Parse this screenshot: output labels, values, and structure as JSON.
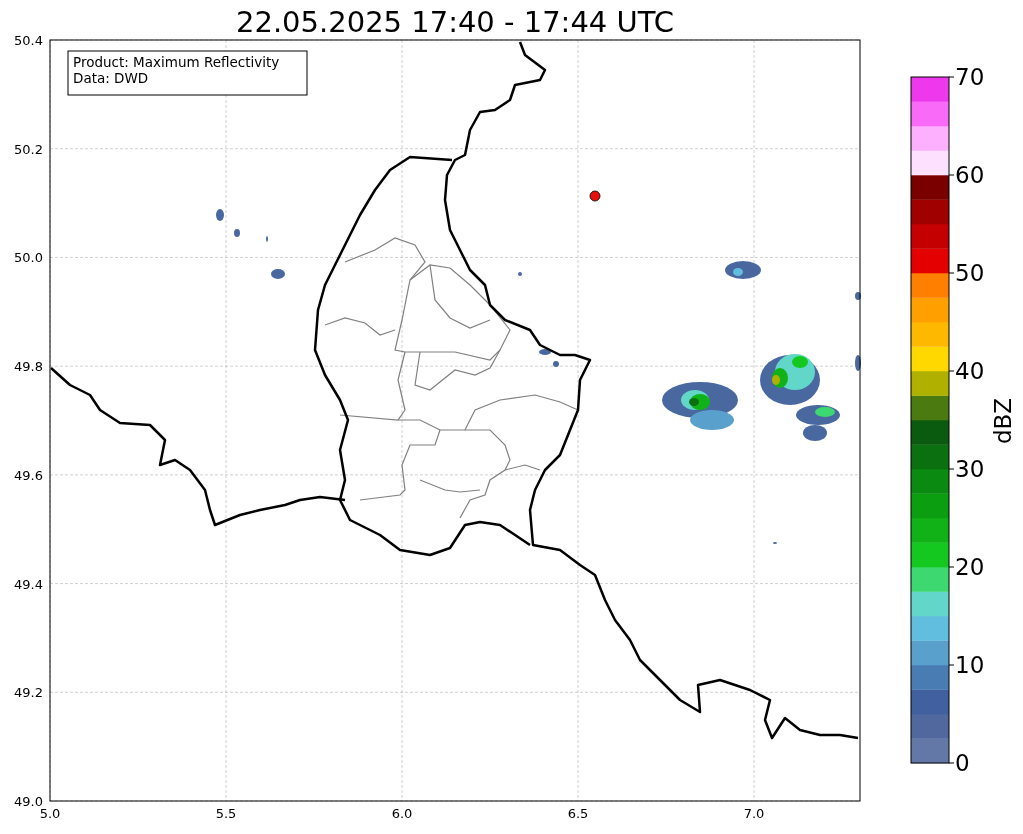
{
  "title": "22.05.2025 17:40 - 17:44 UTC",
  "info_box": {
    "lines": [
      "Product: Maximum Reflectivity",
      "Data: DWD"
    ]
  },
  "map": {
    "xticks": [
      "5.0",
      "5.5",
      "6.0",
      "6.5",
      "7.0"
    ],
    "yticks": [
      "50.4",
      "50.2",
      "50.0",
      "49.8",
      "49.6",
      "49.4",
      "49.2",
      "49.0"
    ]
  },
  "colorbar": {
    "label": "dBZ",
    "ticks": [
      "70",
      "60",
      "50",
      "40",
      "30",
      "20",
      "10",
      "0"
    ],
    "bands": [
      {
        "color": "#6478a8"
      },
      {
        "color": "#50689e"
      },
      {
        "color": "#4060a0"
      },
      {
        "color": "#4a7cb4"
      },
      {
        "color": "#5aa0cc"
      },
      {
        "color": "#62bede"
      },
      {
        "color": "#62d6c8"
      },
      {
        "color": "#3ed870"
      },
      {
        "color": "#14c820"
      },
      {
        "color": "#10b218"
      },
      {
        "color": "#0a9e10"
      },
      {
        "color": "#0a8a10"
      },
      {
        "color": "#0a7010"
      },
      {
        "color": "#0a5a10"
      },
      {
        "color": "#4a7a10"
      },
      {
        "color": "#b0b000"
      },
      {
        "color": "#ffd800"
      },
      {
        "color": "#ffb800"
      },
      {
        "color": "#ff9f00"
      },
      {
        "color": "#ff7f00"
      },
      {
        "color": "#e40000"
      },
      {
        "color": "#c40000"
      },
      {
        "color": "#a00000"
      },
      {
        "color": "#7a0000"
      },
      {
        "color": "#fde0fd"
      },
      {
        "color": "#fdb0fd"
      },
      {
        "color": "#fa6af9"
      },
      {
        "color": "#ee38ee"
      }
    ]
  }
}
